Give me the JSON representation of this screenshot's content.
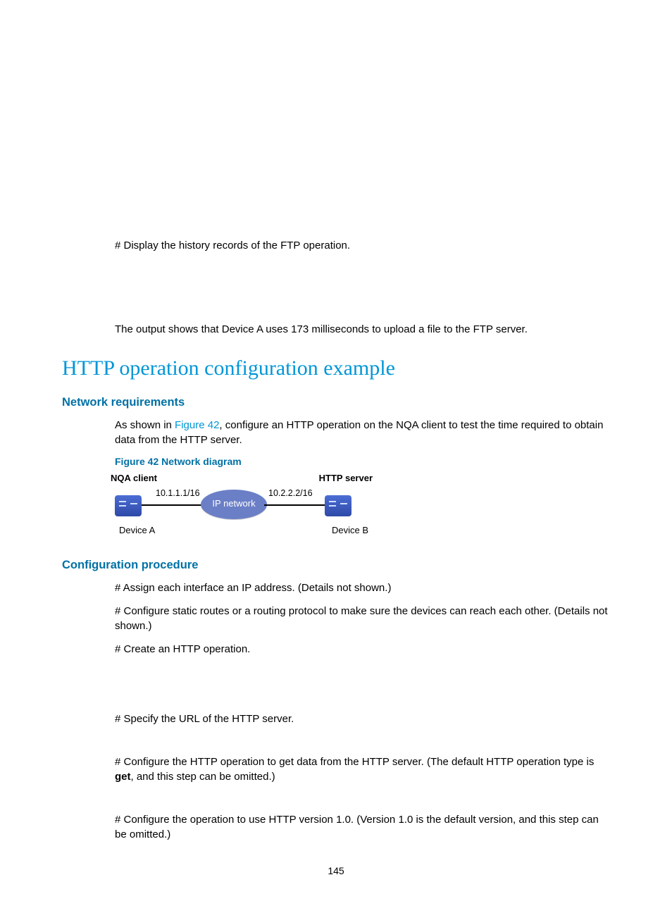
{
  "intro": {
    "line1": "# Display the history records of the FTP operation.",
    "line2": "The output shows that Device A uses 173 milliseconds to upload a file to the FTP server."
  },
  "main_title": "HTTP operation configuration example",
  "section1": {
    "title": "Network requirements",
    "para_pre": "As shown in ",
    "para_link": "Figure 42",
    "para_post": ", configure an HTTP operation on the NQA client to test the time required to obtain data from the HTTP server.",
    "figure_caption": "Figure 42 Network diagram"
  },
  "diagram": {
    "nqa": "NQA client",
    "http": "HTTP server",
    "ip1": "10.1.1.1/16",
    "ip2": "10.2.2.2/16",
    "cloud": "IP network",
    "deviceA": "Device A",
    "deviceB": "Device B"
  },
  "section2": {
    "title": "Configuration procedure",
    "p1": "# Assign each interface an IP address. (Details not shown.)",
    "p2": "# Configure static routes or a routing protocol to make sure the devices can reach each other. (Details not shown.)",
    "p3": "# Create an HTTP operation.",
    "p4": "# Specify the URL of the HTTP server.",
    "p5_pre": "# Configure the HTTP operation to get data from the HTTP server. (The default HTTP operation type is ",
    "p5_bold": "get",
    "p5_post": ", and this step can be omitted.)",
    "p6": "# Configure the operation to use HTTP version 1.0. (Version 1.0 is the default version, and this step can be omitted.)"
  },
  "page_number": "145"
}
